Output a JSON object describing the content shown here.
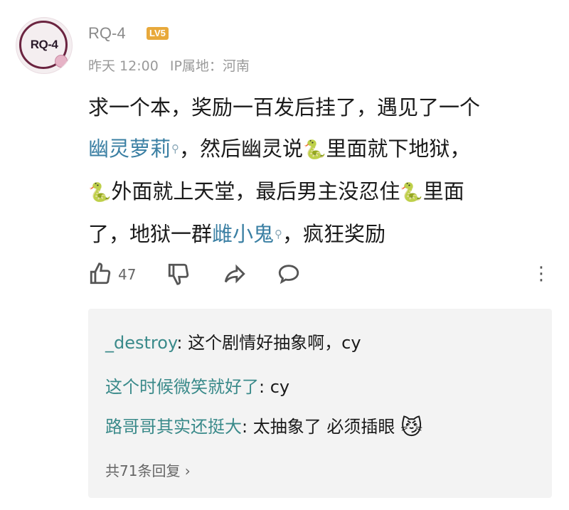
{
  "user": {
    "avatar_text": "RQ-4",
    "name": "RQ-4",
    "level": "LV5",
    "date": "昨天 12:00",
    "ip_location": "IP属地：河南"
  },
  "comment": {
    "line1": "求一个本，奖励一百发后挂了，遇见了一个",
    "kw1": "幽灵萝莉",
    "line2_a": "，然后幽灵说",
    "line2_b": "里面就下地狱，",
    "line3_a": "外面就上天堂，最后男主没忍住",
    "line3_b": "里面",
    "line4_a": "了，地狱一群",
    "kw2": "雌小鬼",
    "line4_b": "，疯狂奖励",
    "snake_glyph": "🐍"
  },
  "actions": {
    "like_count": "47",
    "icons": [
      "thumb-up-icon",
      "thumb-down-icon",
      "share-icon",
      "comment-icon",
      "more-icon"
    ]
  },
  "replies": [
    {
      "author": "_destroy",
      "text": ": 这个剧情好抽象啊，cy"
    },
    {
      "author": "这个时候微笑就好了",
      "text": ": cy"
    },
    {
      "author": "路哥哥其实还挺大",
      "text": ": 太抽象了 必须插眼"
    }
  ],
  "reply_emoji": "😼",
  "total_replies": "共71条回复 ›",
  "colors": {
    "keyword": "#3a7fa3",
    "author": "#3a8a8a",
    "level_badge": "#e8a93b"
  }
}
